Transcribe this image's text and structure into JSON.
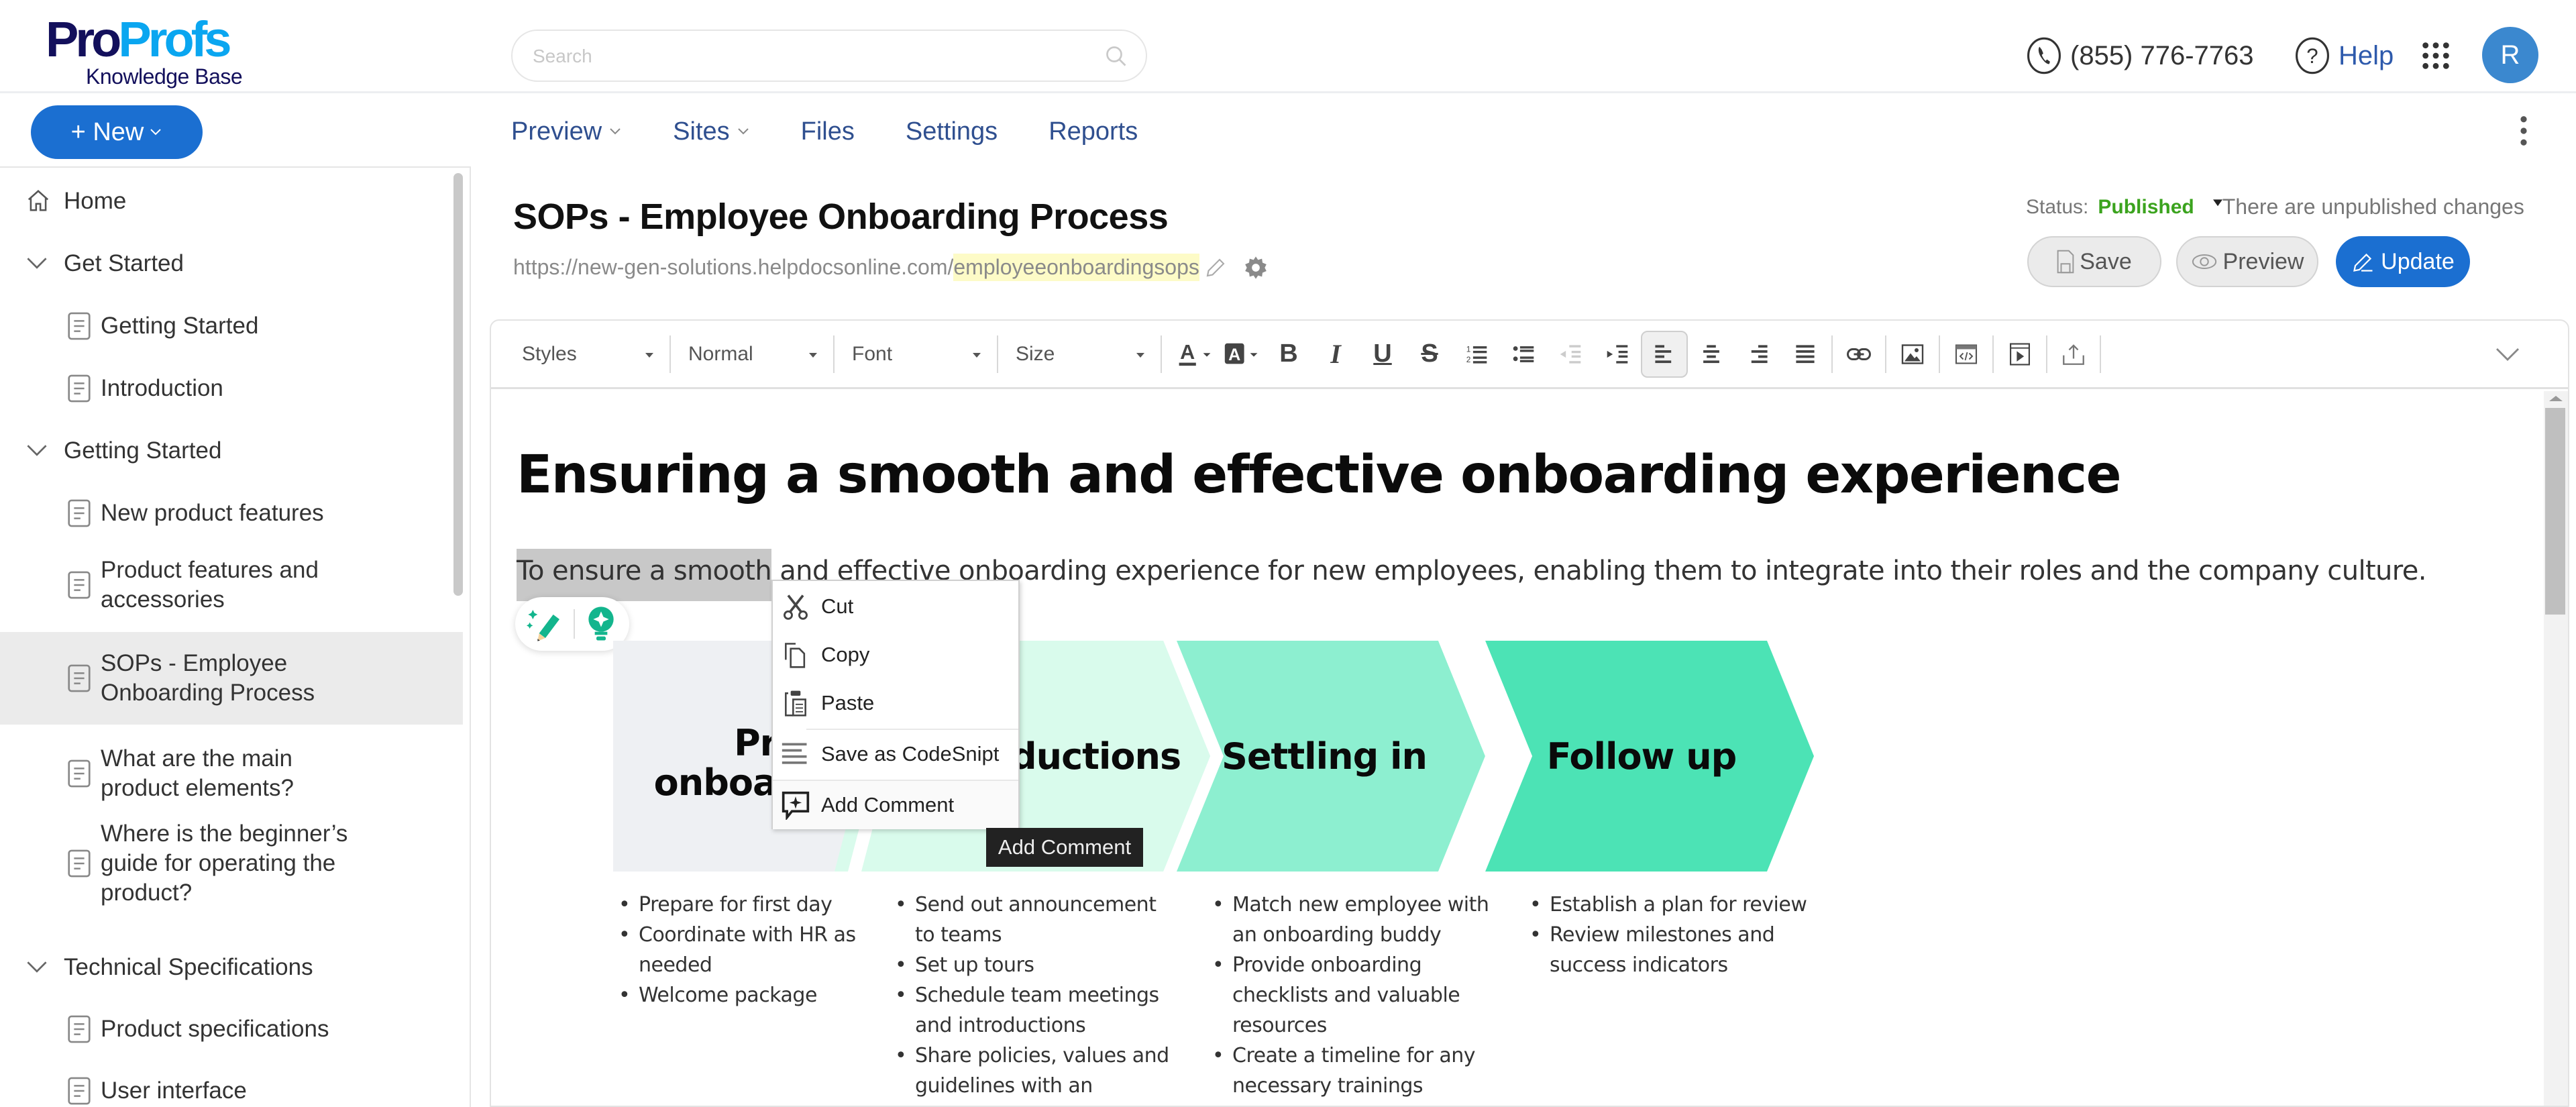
{
  "header": {
    "logo": {
      "part1": "Pro",
      "part2": "Profs",
      "subtitle": "Knowledge Base"
    },
    "search": {
      "placeholder": "Search",
      "value": ""
    },
    "phone": "(855) 776-7763",
    "help_label": "Help",
    "avatar_initial": "R"
  },
  "colors": {
    "brand_dark": "#13105c",
    "brand_light": "#0aa6f0",
    "primary_button": "#1b6fd1",
    "published_green": "#3ba31e",
    "nav_text": "#2f4f8f",
    "stage1": "#eef0f3",
    "stage2": "#d9fbec",
    "stage3": "#8defd0",
    "stage4": "#4ce3b5"
  },
  "toolbar_top": {
    "new_button": "+ New",
    "nav": [
      {
        "label": "Preview",
        "has_dropdown": true
      },
      {
        "label": "Sites",
        "has_dropdown": true
      },
      {
        "label": "Files",
        "has_dropdown": false
      },
      {
        "label": "Settings",
        "has_dropdown": false
      },
      {
        "label": "Reports",
        "has_dropdown": false
      }
    ]
  },
  "sidebar": {
    "items": [
      {
        "type": "home",
        "label": "Home"
      },
      {
        "type": "category",
        "label": "Get Started",
        "expanded": true
      },
      {
        "type": "article",
        "label": "Getting Started"
      },
      {
        "type": "article",
        "label": "Introduction"
      },
      {
        "type": "category",
        "label": "Getting Started",
        "expanded": true
      },
      {
        "type": "article",
        "label": "New product features"
      },
      {
        "type": "article",
        "label": "Product features and accessories"
      },
      {
        "type": "article",
        "label": "SOPs - Employee Onboarding Process",
        "selected": true
      },
      {
        "type": "article",
        "label": "What are the main product elements?"
      },
      {
        "type": "article",
        "label": "Where is the beginner’s guide for operating the product?"
      },
      {
        "type": "category",
        "label": "Technical Specifications",
        "expanded": true
      },
      {
        "type": "article",
        "label": "Product specifications"
      },
      {
        "type": "article",
        "label": "User interface"
      }
    ]
  },
  "article": {
    "title": "SOPs - Employee Onboarding Process",
    "url_base": "https://new-gen-solutions.helpdocsonline.com/",
    "url_slug": "employeeonboardingsops",
    "status_label": "Status:",
    "status_value": "Published",
    "unpublished_note": "There are unpublished changes",
    "buttons": {
      "save": "Save",
      "preview": "Preview",
      "update": "Update"
    }
  },
  "editor": {
    "toolbar": {
      "styles": "Styles",
      "format": "Normal",
      "font": "Font",
      "size": "Size"
    },
    "heading": "Ensuring a smooth and effective onboarding experience",
    "paragraph_selected": "To ensure a smooth",
    "paragraph_rest": " and effective onboarding experience for new employees, enabling them to integrate into their roles and the company culture.",
    "diagram": {
      "stages": [
        {
          "title": "Pre onboarding",
          "line1": "Pre",
          "line2": "onboarding"
        },
        {
          "title": "Introductions"
        },
        {
          "title": "Settling in"
        },
        {
          "title": "Follow up"
        }
      ],
      "bullets": [
        [
          "Prepare for first day",
          "Coordinate with HR as needed",
          "Welcome package"
        ],
        [
          "Send out announcement to teams",
          "Set up tours",
          "Schedule team meetings and introductions",
          "Share policies, values and guidelines with an"
        ],
        [
          "Match new employee with an onboarding buddy",
          "Provide onboarding checklists and valuable resources",
          "Create a timeline for any necessary trainings"
        ],
        [
          "Establish a plan for review",
          "Review milestones and success indicators"
        ]
      ]
    }
  },
  "context_menu": {
    "items": [
      {
        "label": "Cut",
        "icon": "scissors-icon"
      },
      {
        "label": "Copy",
        "icon": "copy-icon"
      },
      {
        "label": "Paste",
        "icon": "paste-icon"
      },
      {
        "label": "Save as CodeSnipt",
        "icon": "code-snippet-icon"
      },
      {
        "label": "Add Comment",
        "icon": "add-comment-icon"
      }
    ],
    "tooltip": "Add Comment"
  }
}
